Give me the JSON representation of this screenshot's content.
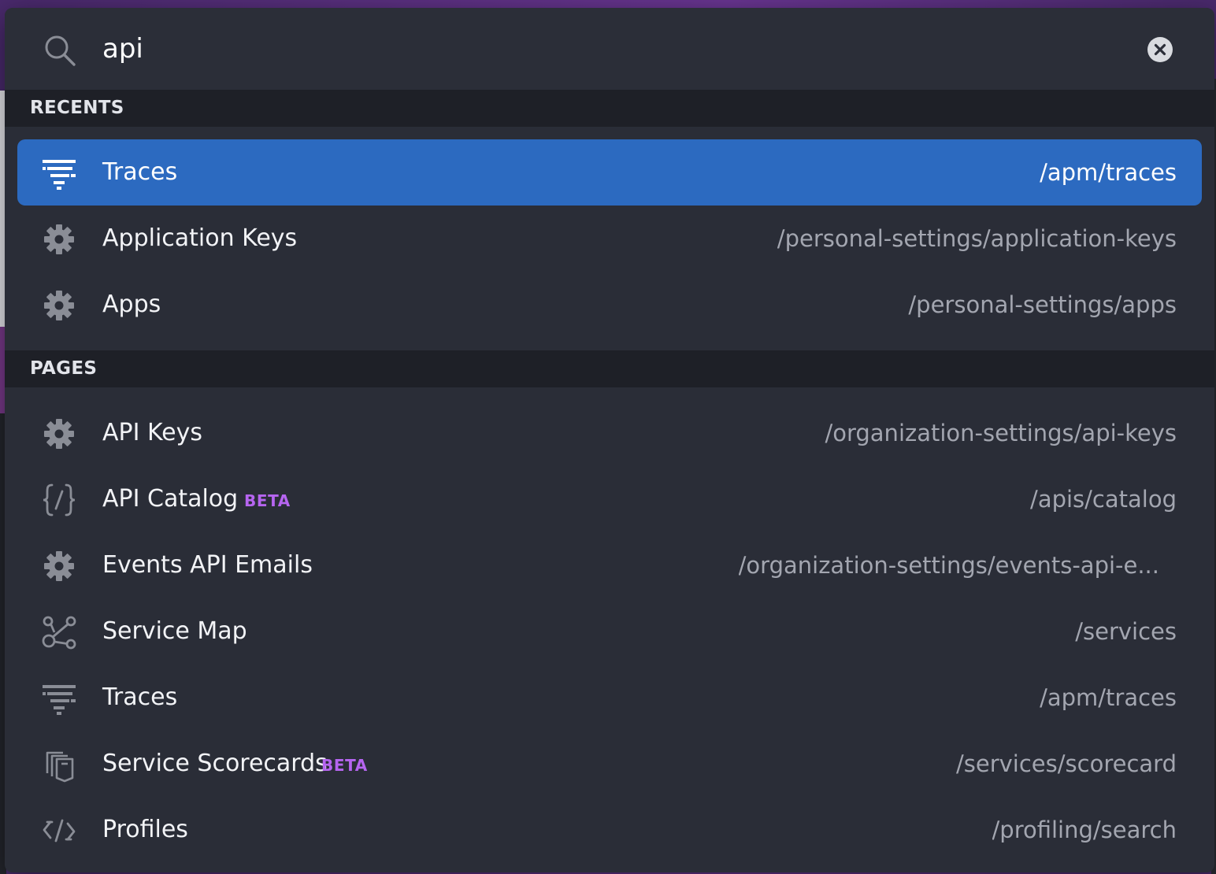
{
  "search": {
    "query": "api",
    "search_icon": "search-icon",
    "clear_icon": "clear-circle-icon"
  },
  "sections": {
    "recents": {
      "title": "RECENTS",
      "items": [
        {
          "label": "Traces",
          "path": "/apm/traces",
          "icon": "traces-icon",
          "selected": true
        },
        {
          "label": "Application Keys",
          "path": "/personal-settings/application-keys",
          "icon": "gear-icon"
        },
        {
          "label": "Apps",
          "path": "/personal-settings/apps",
          "icon": "gear-icon"
        }
      ]
    },
    "pages": {
      "title": "PAGES",
      "items": [
        {
          "label": "API Keys",
          "path": "/organization-settings/api-keys",
          "icon": "gear-icon"
        },
        {
          "label": "API Catalog",
          "badge": "BETA",
          "path": "/apis/catalog",
          "icon": "api-catalog-icon"
        },
        {
          "label": "Events API Emails",
          "path": "/organization-settings/events-api-e...",
          "icon": "gear-icon"
        },
        {
          "label": "Service Map",
          "path": "/services",
          "icon": "service-map-icon"
        },
        {
          "label": "Traces",
          "path": "/apm/traces",
          "icon": "traces-icon"
        },
        {
          "label": "Service Scorecards",
          "badge": "BETA",
          "path": "/services/scorecard",
          "icon": "scorecards-icon"
        },
        {
          "label": "Profiles",
          "path": "/profiling/search",
          "icon": "profiles-icon"
        }
      ]
    }
  },
  "colors": {
    "selected_row": "#2c6ac0",
    "beta_badge": "#b665f0",
    "panel": "#2a2d37",
    "section_header": "#1e2027"
  }
}
